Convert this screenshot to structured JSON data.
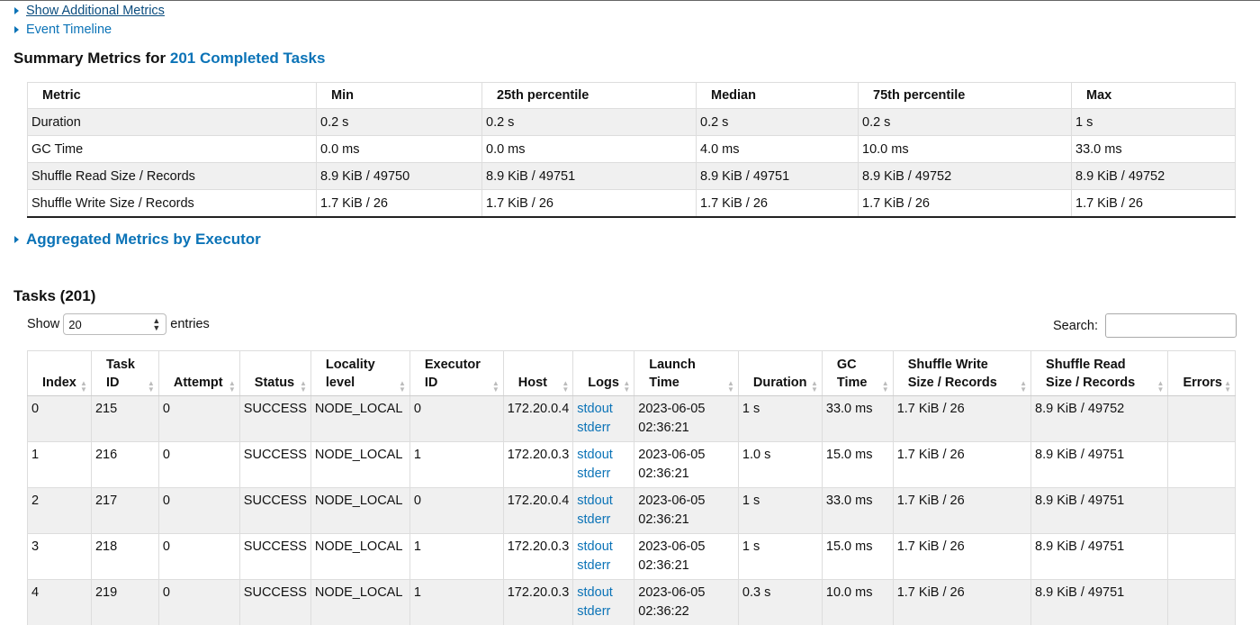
{
  "toggles": {
    "show_additional_metrics": "Show Additional Metrics",
    "event_timeline": "Event Timeline"
  },
  "summary": {
    "title_prefix": "Summary Metrics for",
    "title_link": "201 Completed Tasks",
    "headers": [
      "Metric",
      "Min",
      "25th percentile",
      "Median",
      "75th percentile",
      "Max"
    ],
    "rows": [
      [
        "Duration",
        "0.2 s",
        "0.2 s",
        "0.2 s",
        "0.2 s",
        "1 s"
      ],
      [
        "GC Time",
        "0.0 ms",
        "0.0 ms",
        "4.0 ms",
        "10.0 ms",
        "33.0 ms"
      ],
      [
        "Shuffle Read Size / Records",
        "8.9 KiB / 49750",
        "8.9 KiB / 49751",
        "8.9 KiB / 49751",
        "8.9 KiB / 49752",
        "8.9 KiB / 49752"
      ],
      [
        "Shuffle Write Size / Records",
        "1.7 KiB / 26",
        "1.7 KiB / 26",
        "1.7 KiB / 26",
        "1.7 KiB / 26",
        "1.7 KiB / 26"
      ]
    ]
  },
  "aggregated": {
    "label": "Aggregated Metrics by Executor"
  },
  "tasks": {
    "title": "Tasks (201)",
    "show_label": "Show",
    "page_size": "20",
    "entries_label": "entries",
    "search_label": "Search:",
    "search_value": "",
    "headers": [
      [
        "Index"
      ],
      [
        "Task",
        "ID"
      ],
      [
        "Attempt"
      ],
      [
        "Status"
      ],
      [
        "Locality",
        "level"
      ],
      [
        "Executor",
        "ID"
      ],
      [
        "Host"
      ],
      [
        "Logs"
      ],
      [
        "Launch",
        "Time"
      ],
      [
        "Duration"
      ],
      [
        "GC",
        "Time"
      ],
      [
        "Shuffle Write",
        "Size / Records"
      ],
      [
        "Shuffle Read",
        "Size / Records"
      ],
      [
        "Errors"
      ]
    ],
    "rows": [
      {
        "index": "0",
        "task_id": "215",
        "attempt": "0",
        "status": "SUCCESS",
        "locality": "NODE_LOCAL",
        "executor": "0",
        "host": "172.20.0.4",
        "stdout": "stdout",
        "stderr": "stderr",
        "launch_date": "2023-06-05",
        "launch_time": "02:36:21",
        "duration": "1 s",
        "gc": "33.0 ms",
        "write": "1.7 KiB / 26",
        "read": "8.9 KiB / 49752",
        "errors": ""
      },
      {
        "index": "1",
        "task_id": "216",
        "attempt": "0",
        "status": "SUCCESS",
        "locality": "NODE_LOCAL",
        "executor": "1",
        "host": "172.20.0.3",
        "stdout": "stdout",
        "stderr": "stderr",
        "launch_date": "2023-06-05",
        "launch_time": "02:36:21",
        "duration": "1.0 s",
        "gc": "15.0 ms",
        "write": "1.7 KiB / 26",
        "read": "8.9 KiB / 49751",
        "errors": ""
      },
      {
        "index": "2",
        "task_id": "217",
        "attempt": "0",
        "status": "SUCCESS",
        "locality": "NODE_LOCAL",
        "executor": "0",
        "host": "172.20.0.4",
        "stdout": "stdout",
        "stderr": "stderr",
        "launch_date": "2023-06-05",
        "launch_time": "02:36:21",
        "duration": "1 s",
        "gc": "33.0 ms",
        "write": "1.7 KiB / 26",
        "read": "8.9 KiB / 49751",
        "errors": ""
      },
      {
        "index": "3",
        "task_id": "218",
        "attempt": "0",
        "status": "SUCCESS",
        "locality": "NODE_LOCAL",
        "executor": "1",
        "host": "172.20.0.3",
        "stdout": "stdout",
        "stderr": "stderr",
        "launch_date": "2023-06-05",
        "launch_time": "02:36:21",
        "duration": "1 s",
        "gc": "15.0 ms",
        "write": "1.7 KiB / 26",
        "read": "8.9 KiB / 49751",
        "errors": ""
      },
      {
        "index": "4",
        "task_id": "219",
        "attempt": "0",
        "status": "SUCCESS",
        "locality": "NODE_LOCAL",
        "executor": "1",
        "host": "172.20.0.3",
        "stdout": "stdout",
        "stderr": "stderr",
        "launch_date": "2023-06-05",
        "launch_time": "02:36:22",
        "duration": "0.3 s",
        "gc": "10.0 ms",
        "write": "1.7 KiB / 26",
        "read": "8.9 KiB / 49751",
        "errors": ""
      }
    ]
  }
}
